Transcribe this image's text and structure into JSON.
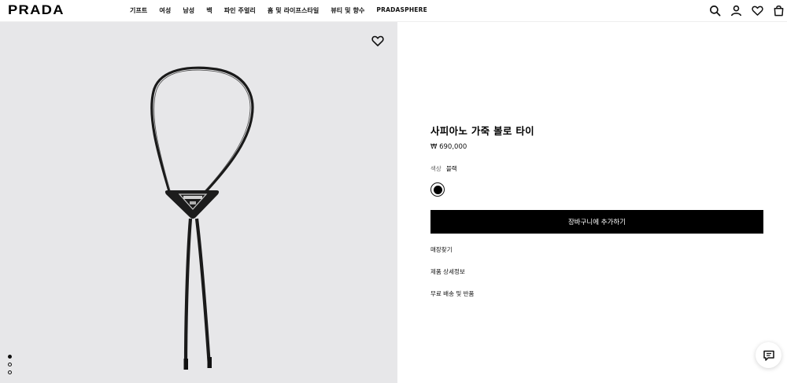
{
  "brand": {
    "logo_text": "PRADA"
  },
  "nav": {
    "items": [
      {
        "label": "기프트"
      },
      {
        "label": "여성"
      },
      {
        "label": "남성"
      },
      {
        "label": "백"
      },
      {
        "label": "파인 주얼리"
      },
      {
        "label": "홈 및 라이프스타일"
      },
      {
        "label": "뷰티 및 향수"
      },
      {
        "label": "PRADASPHERE"
      }
    ]
  },
  "header_icons": [
    "search-icon",
    "account-icon",
    "wishlist-icon",
    "shopping-bag-icon"
  ],
  "product": {
    "title": "사피아노 가죽 볼로 타이",
    "price": "₩ 690,000",
    "color_label": "색상",
    "color_value": "블랙",
    "swatch_color": "#000000",
    "add_to_cart": "장바구니에 추가하기",
    "links": {
      "store": "매장찾기",
      "details": "제품 상세정보",
      "shipping": "무료 배송 및 반품"
    },
    "image_background": "#e7e7e9"
  },
  "gallery": {
    "dot_count": 3,
    "active_index": 0
  },
  "colors": {
    "accent": "#000000",
    "button_text": "#ffffff"
  }
}
